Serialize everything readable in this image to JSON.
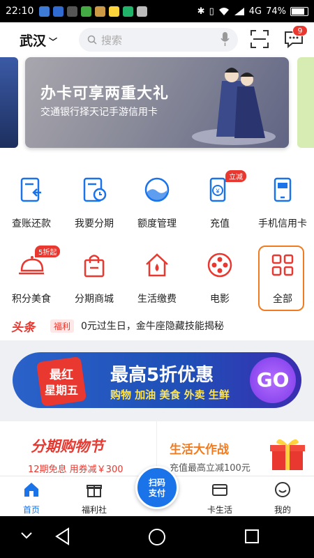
{
  "status_bar": {
    "time": "22:10",
    "network": "4G",
    "battery": "74%"
  },
  "header": {
    "city": "武汉",
    "search_placeholder": "搜索",
    "message_count": "9"
  },
  "banner": {
    "title": "办卡可享两重大礼",
    "subtitle": "交通银行择天记手游信用卡"
  },
  "quick_icons": {
    "row1": [
      {
        "label": "查账还款"
      },
      {
        "label": "我要分期"
      },
      {
        "label": "额度管理"
      },
      {
        "label": "充值",
        "tag": "立减"
      },
      {
        "label": "手机信用卡"
      }
    ],
    "row2": [
      {
        "label": "积分美食",
        "tag": "5折起"
      },
      {
        "label": "分期商城"
      },
      {
        "label": "生活缴费"
      },
      {
        "label": "电影"
      },
      {
        "label": "全部"
      }
    ]
  },
  "news": {
    "logo": "头条",
    "tag": "福利",
    "text": "0元过生日，金牛座隐藏技能揭秘"
  },
  "promo": {
    "badge_line1": "最红",
    "badge_line2": "星期五",
    "headline": "最高5折优惠",
    "subline": "购物 加油 美食 外卖 生鲜",
    "go": "GO"
  },
  "cards": {
    "left": {
      "title": "分期购物节",
      "subtitle": "12期免息 用券减￥300"
    },
    "right": {
      "title": "生活大作战",
      "subtitle": "充值最高立减100元"
    }
  },
  "tabbar": {
    "items": [
      {
        "label": "首页"
      },
      {
        "label": "福利社"
      },
      {
        "label": "卡生活"
      },
      {
        "label": "我的"
      }
    ],
    "center_line1": "扫码",
    "center_line2": "支付"
  },
  "colors": {
    "brand_blue": "#1a73e8",
    "accent_red": "#e8382f",
    "highlight_orange": "#f07b20"
  }
}
